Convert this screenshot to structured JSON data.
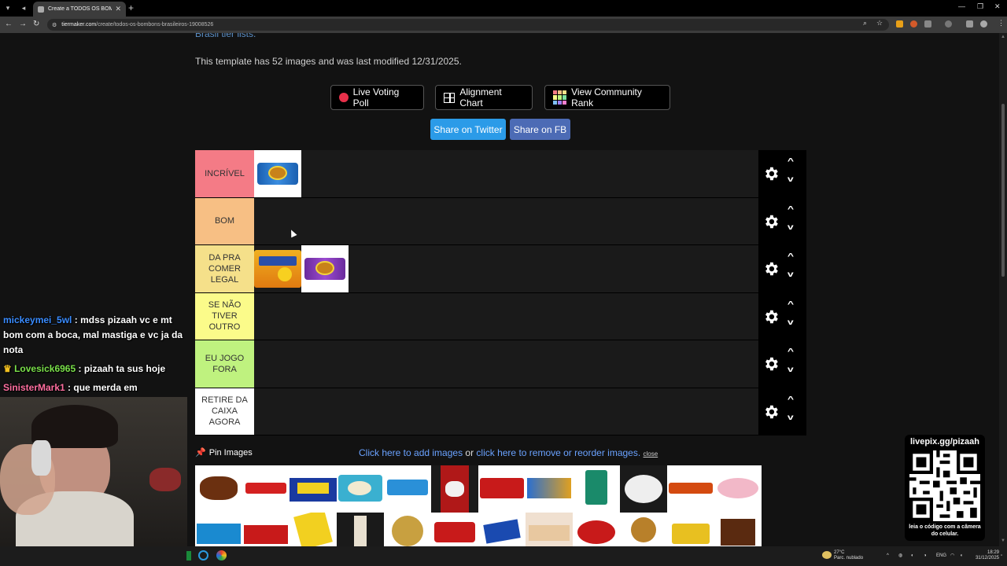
{
  "browser": {
    "tab_title": "Create a TODOS OS BOMBONS",
    "url_host": "tiermaker.com",
    "url_path": "/create/todos-os-bombons-brasileiros-19008526"
  },
  "page": {
    "cut_link": "Brasil tier lists.",
    "template_info": "This template has 52 images and was last modified 12/31/2025.",
    "buttons": {
      "live_voting": "Live Voting Poll",
      "alignment": "Alignment Chart",
      "community_rank": "View Community Rank",
      "share_twitter": "Share on Twitter",
      "share_fb": "Share on FB"
    },
    "tiers": [
      {
        "label": "INCRÍVEL",
        "color": "#f47b86"
      },
      {
        "label": "BOM",
        "color": "#f7bf84"
      },
      {
        "label": "DA PRA COMER LEGAL",
        "color": "#f5e08a"
      },
      {
        "label": "SE NÃO TIVER OUTRO",
        "color": "#fbfb8a"
      },
      {
        "label": "EU JOGO FORA",
        "color": "#bff27f"
      },
      {
        "label": "RETIRE DA CAIXA AGORA",
        "color": "#ffffff"
      }
    ],
    "pin_images": "Pin Images",
    "add_images": {
      "link1": "Click here to add images",
      "or": " or ",
      "link2": "click here to remove or reorder images.",
      "close": "close"
    }
  },
  "chat": {
    "messages": [
      {
        "user": "mickeymei_5wl",
        "user_color": "#3a8cff",
        "text": " : mdss pizaah vc e mt bom com a boca, mal mastiga e vc ja da nota"
      },
      {
        "user": "Lovesick6965",
        "user_color": "#7ae04a",
        "text": " : pizaah ta sus hoje"
      },
      {
        "user": "SinisterMark1",
        "user_color": "#ff6fa0",
        "text": " : que merda em"
      }
    ]
  },
  "overlay": {
    "qr_title": "livepix.gg/pizaah",
    "qr_caption": "leia o código com a câmera do celular."
  },
  "taskbar": {
    "weather_temp": "27°C",
    "weather_desc": "Parc. nublado",
    "lang": "ENG",
    "time": "18:29",
    "date": "31/12/2025"
  }
}
